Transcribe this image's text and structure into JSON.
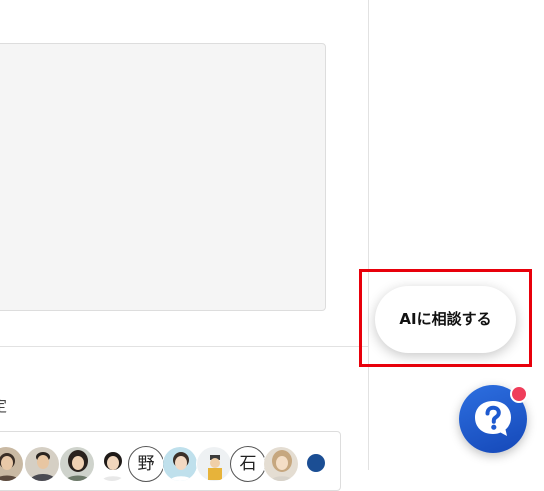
{
  "main": {
    "text_area_value": "",
    "section_label": "定",
    "members": [
      {
        "type": "photo",
        "icon": "person-photo-icon"
      },
      {
        "type": "photo",
        "icon": "person-photo-icon"
      },
      {
        "type": "photo",
        "icon": "person-photo-icon"
      },
      {
        "type": "photo",
        "icon": "person-photo-icon"
      },
      {
        "type": "text",
        "label": "野"
      },
      {
        "type": "photo",
        "icon": "person-photo-icon"
      },
      {
        "type": "photo",
        "icon": "person-photo-icon"
      },
      {
        "type": "text",
        "label": "石"
      },
      {
        "type": "photo",
        "icon": "person-photo-icon"
      },
      {
        "type": "color",
        "color": "#1b4e94"
      }
    ]
  },
  "floating": {
    "ai_button_label": "AIに相談する",
    "help_icon": "question-bubble-icon",
    "help_color": "#1e5ad0",
    "notification_color": "#ef3d5a",
    "highlight_color": "#e8000b"
  }
}
